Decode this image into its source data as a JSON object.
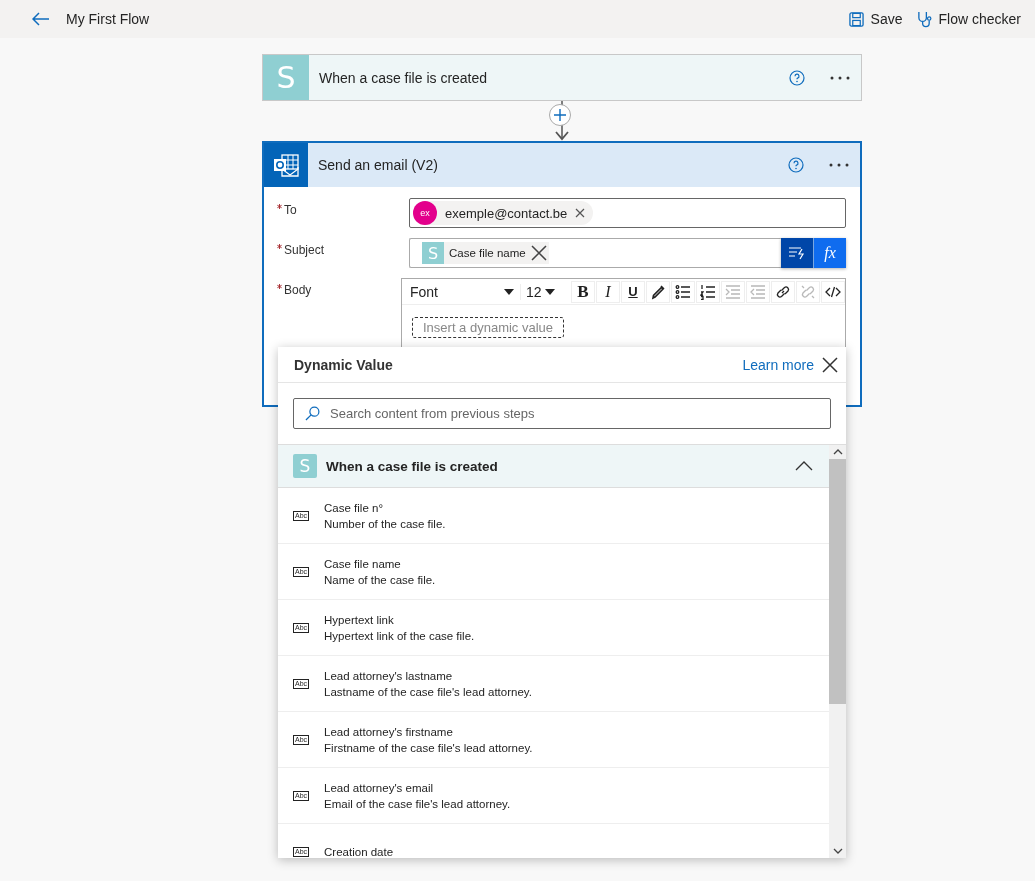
{
  "header": {
    "title": "My First Flow",
    "actions": [
      {
        "kind": "save",
        "label": "Save"
      },
      {
        "kind": "checker",
        "label": "Flow checker"
      }
    ]
  },
  "trigger": {
    "icon_letter": "S",
    "title": "When a case file is created"
  },
  "action": {
    "title": "Send an email (V2)",
    "fields": [
      {
        "kind": "recipients",
        "label": "To",
        "required": true,
        "tokens": [
          {
            "initials": "ex",
            "text": "exemple@contact.be"
          }
        ]
      },
      {
        "kind": "dynamic",
        "label": "Subject",
        "required": true,
        "tokens": [
          {
            "icon_letter": "S",
            "text": "Case file name"
          }
        ],
        "expression_button": "fx"
      },
      {
        "kind": "rich",
        "label": "Body",
        "required": true,
        "font": "Font",
        "size": "12",
        "tools": [
          {
            "kind": "bold",
            "glyph": "B",
            "disabled": false
          },
          {
            "kind": "italic",
            "glyph": "I",
            "disabled": false
          },
          {
            "kind": "underline",
            "glyph": "U",
            "disabled": false
          },
          {
            "kind": "color",
            "disabled": false
          },
          {
            "kind": "bullets",
            "disabled": false
          },
          {
            "kind": "numbers",
            "disabled": false
          },
          {
            "kind": "indent",
            "disabled": true
          },
          {
            "kind": "outdent",
            "disabled": true
          },
          {
            "kind": "link",
            "disabled": false
          },
          {
            "kind": "unlink",
            "disabled": true
          },
          {
            "kind": "code",
            "disabled": false
          }
        ],
        "placeholder": "Insert a dynamic value"
      }
    ]
  },
  "dynamic_panel": {
    "title": "Dynamic Value",
    "link": "Learn more",
    "search_placeholder": "Search content from previous steps",
    "group": {
      "icon_letter": "S",
      "title": "When a case file is created",
      "expanded": true,
      "items": [
        {
          "type_label": "Abc",
          "name": "Case file n°",
          "description": "Number of the case file."
        },
        {
          "type_label": "Abc",
          "name": "Case file name",
          "description": "Name of the case file."
        },
        {
          "type_label": "Abc",
          "name": "Hypertext link",
          "description": "Hypertext link of the case file."
        },
        {
          "type_label": "Abc",
          "name": "Lead attorney's lastname",
          "description": "Lastname of the case file's lead attorney."
        },
        {
          "type_label": "Abc",
          "name": "Lead attorney's firstname",
          "description": "Firstname of the case file's lead attorney."
        },
        {
          "type_label": "Abc",
          "name": "Lead attorney's email",
          "description": "Email of the case file's lead attorney."
        },
        {
          "type_label": "Abc",
          "name": "Creation date"
        }
      ]
    }
  }
}
